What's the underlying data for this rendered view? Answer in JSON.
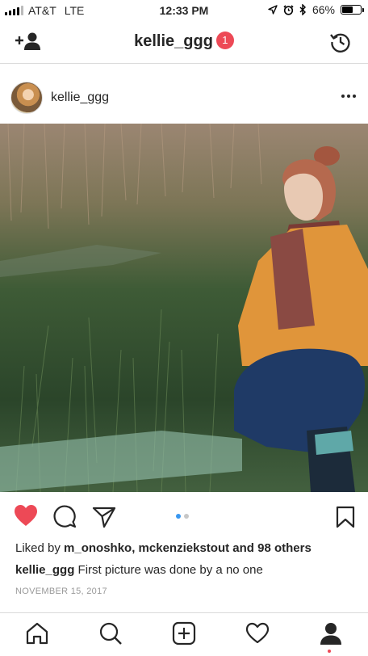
{
  "status_bar": {
    "carrier": "AT&T",
    "network": "LTE",
    "time": "12:33 PM",
    "battery": "66%",
    "battery_level": 0.66
  },
  "header": {
    "title": "kellie_ggg",
    "badge_count": "1"
  },
  "post": {
    "username": "kellie_ggg",
    "likes_prefix": "Liked by ",
    "likes_users": "m_onoshko, mckenziekstout",
    "likes_suffix": " and 98 others",
    "caption_user": "kellie_ggg",
    "caption_text": "First picture was done by a no one",
    "date": "NOVEMBER 15, 2017",
    "carousel_total": 2,
    "carousel_active": 1
  },
  "colors": {
    "like_red": "#ed4956",
    "dot_active": "#3897f0",
    "badge": "#ed4956"
  },
  "icons": {
    "header": [
      "add-user-icon",
      "history-icon"
    ],
    "actions": [
      "heart-icon",
      "comment-icon",
      "share-icon",
      "bookmark-icon"
    ],
    "tabs": [
      "home-icon",
      "search-icon",
      "add-post-icon",
      "activity-icon",
      "profile-icon"
    ]
  }
}
